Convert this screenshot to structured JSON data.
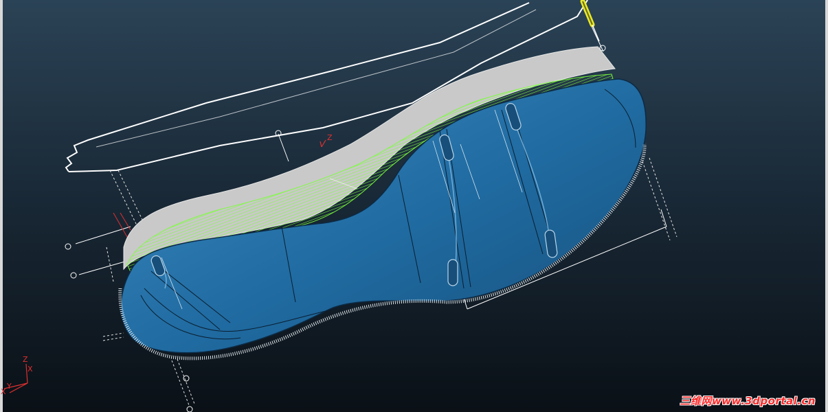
{
  "viewport": {
    "background_top": "#2b4356",
    "background_bottom": "#0a1016"
  },
  "model": {
    "sole_color": "#1f6aa0",
    "sole_highlight": "#3d8cc4",
    "upper_color": "#c9c9c9",
    "hatch_color": "#7cff3a",
    "wire_color": "#ffffff",
    "handle_color": "#e8e82a"
  },
  "labels": {
    "model_axis_z": "Z",
    "triad_z": "Z",
    "triad_x_upper": "X",
    "triad_y": "Y",
    "triad_x_lower": "X"
  },
  "watermark": {
    "text": "三维网www.3dportal.cn",
    "color": "#ff2a2a"
  }
}
